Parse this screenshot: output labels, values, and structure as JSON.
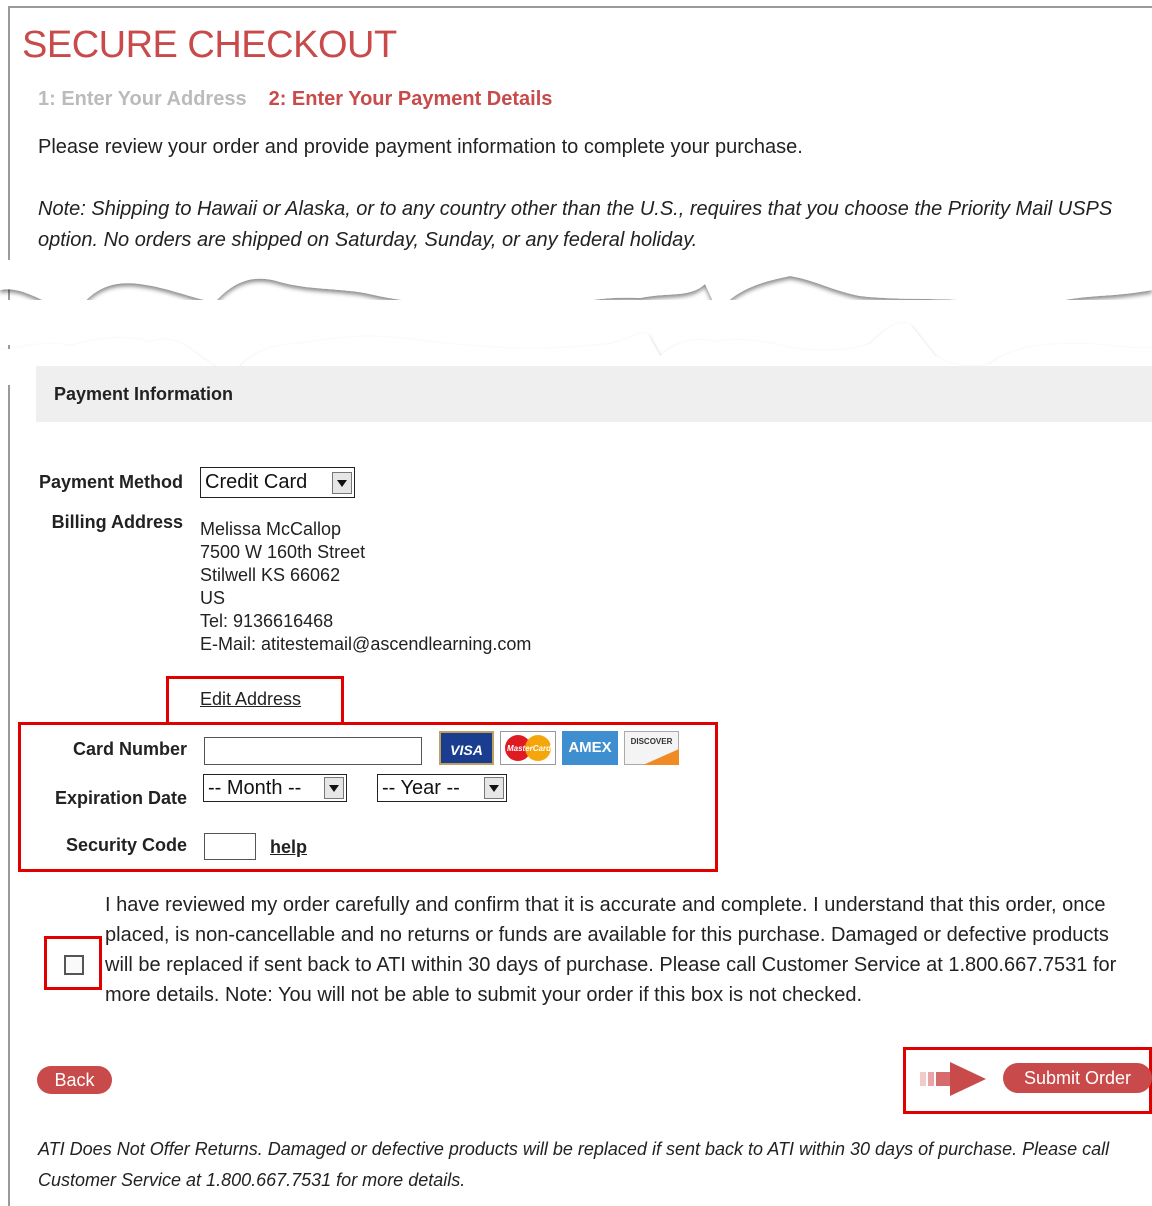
{
  "page": {
    "title": "SECURE CHECKOUT",
    "step1": "1: Enter Your Address",
    "step2": "2: Enter Your Payment Details",
    "intro": "Please review your order and provide payment information to complete your purchase.",
    "note": "Note: Shipping to Hawaii or Alaska, or to any country other than the U.S., requires that you choose the Priority Mail USPS option. No orders are shipped on Saturday, Sunday, or any federal holiday."
  },
  "payment": {
    "header": "Payment Information",
    "method_label": "Payment Method",
    "method_value": "Credit Card",
    "billing_label": "Billing Address",
    "billing": {
      "name": "Melissa McCallop",
      "street": "7500 W 160th Street",
      "city": "Stilwell KS 66062",
      "country": "US",
      "tel": "Tel: 9136616468",
      "email": "E-Mail: atitestemail@ascendlearning.com"
    },
    "edit_address": "Edit Address",
    "card_number_label": "Card Number",
    "card_number_value": "",
    "expiration_label": "Expiration Date",
    "month_value": "-- Month --",
    "year_value": "-- Year --",
    "security_label": "Security Code",
    "help": "help",
    "cards": [
      "VISA",
      "MasterCard",
      "AMEX",
      "DISCOVER"
    ]
  },
  "agreement": {
    "checked": false,
    "text": "I have reviewed my order carefully and confirm that it is accurate and complete. I understand that this order, once placed, is non-cancellable and no returns or funds are available for this purchase. Damaged or defective products will be replaced if sent back to ATI within 30 days of purchase. Please call Customer Service at 1.800.667.7531 for more details. Note: You will not be able to submit your order if this box is not checked."
  },
  "buttons": {
    "back": "Back",
    "submit": "Submit Order"
  },
  "footer": "ATI Does Not Offer Returns. Damaged or defective products will be replaced if sent back to ATI within 30 days of purchase. Please call Customer Service at 1.800.667.7531 for more details.",
  "colors": {
    "accent": "#c94a4a",
    "highlight": "#e00000",
    "muted": "#bbbbbb"
  }
}
